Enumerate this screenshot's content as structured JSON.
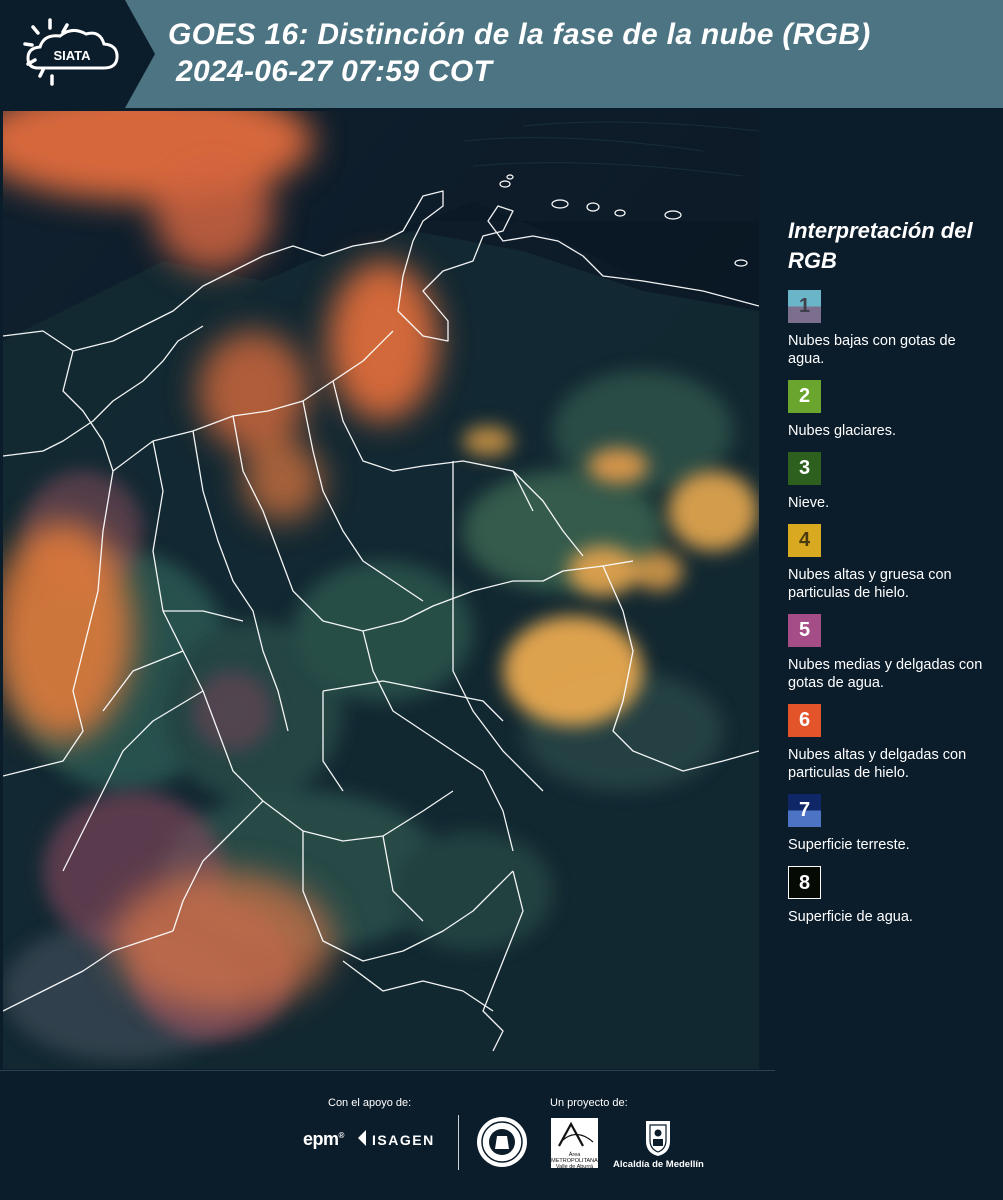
{
  "header": {
    "logo_text": "SIATA",
    "title_line1": "GOES 16: Distinción de la fase de la nube (RGB)",
    "title_line2": "2024-06-27 07:59 COT"
  },
  "legend": {
    "title": "Interpretación del RGB",
    "items": [
      {
        "number": "1",
        "label": "Nubes bajas con gotas de agua.",
        "color_top": "#6ab6c8",
        "color_bottom": "#7c6f8e",
        "text_color": "#3f3f4a"
      },
      {
        "number": "2",
        "label": "Nubes glaciares.",
        "color_top": "#6aa62e",
        "color_bottom": "#6aa62e",
        "text_color": "#ffffff"
      },
      {
        "number": "3",
        "label": "Nieve.",
        "color_top": "#2d5f1e",
        "color_bottom": "#2d5f1e",
        "text_color": "#ffffff"
      },
      {
        "number": "4",
        "label": "Nubes altas y gruesa con particulas de hielo.",
        "color_top": "#d9a91f",
        "color_bottom": "#d9a91f",
        "text_color": "#4a3a10"
      },
      {
        "number": "5",
        "label": "Nubes medias y delgadas con gotas de agua.",
        "color_top": "#a44d86",
        "color_bottom": "#a44d86",
        "text_color": "#ffffff"
      },
      {
        "number": "6",
        "label": "Nubes altas y delgadas con particulas de hielo.",
        "color_top": "#e4542a",
        "color_bottom": "#e4542a",
        "text_color": "#ffffff"
      },
      {
        "number": "7",
        "label": "Superficie terreste.",
        "color_top": "#0f2766",
        "color_bottom": "#4d74c4",
        "text_color": "#ffffff"
      },
      {
        "number": "8",
        "label": "Superficie de agua.",
        "color_top": "#050a05",
        "color_bottom": "#050a05",
        "text_color": "#ffffff"
      }
    ]
  },
  "footer": {
    "support_label": "Con el apoyo de:",
    "project_label": "Un proyecto de:",
    "sponsor_1": "epm",
    "sponsor_2": "ISAGEN",
    "partner_amva": "Área METROPOLITANA Valle de Aburrá",
    "partner_alcaldia": "Alcaldía de Medellín"
  }
}
